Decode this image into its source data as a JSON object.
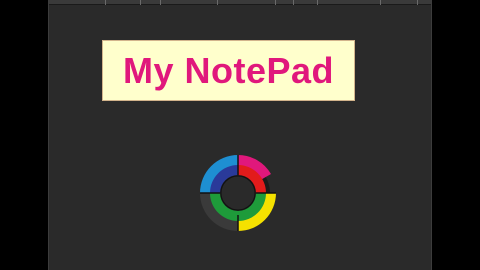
{
  "app": {
    "title": "My NotePad"
  },
  "logo": {
    "icon": "color-ring-logo-icon",
    "segment_colors": [
      "#1e8fd2",
      "#e0187c",
      "#e21b1b",
      "#f5e100",
      "#3a3a3a",
      "#1e9b3a",
      "#2a3a9a"
    ]
  },
  "colors": {
    "title_text": "#e0187c",
    "title_background": "#ffffcc",
    "window_background": "#2a2a2a",
    "letterbox": "#000000"
  }
}
